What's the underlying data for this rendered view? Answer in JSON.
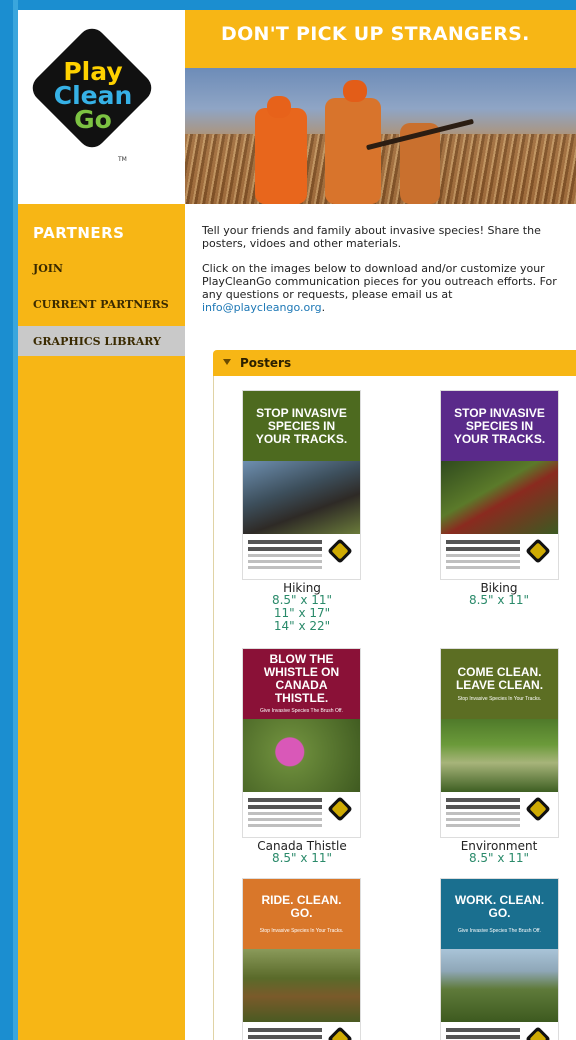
{
  "header": {
    "title": "DON'T PICK UP STRANGERS."
  },
  "logo": {
    "line1": "Play",
    "line2": "Clean",
    "line3": "Go",
    "tm": "TM"
  },
  "sidebar": {
    "title": "PARTNERS",
    "items": [
      {
        "label": "JOIN"
      },
      {
        "label": "CURRENT PARTNERS"
      },
      {
        "label": "GRAPHICS LIBRARY"
      }
    ]
  },
  "intro": {
    "p1": "Tell your friends and family about invasive species! Share the posters, vidoes and other materials.",
    "p2": "Click on the images below to download and/or customize your PlayCleanGo communication pieces for you outreach efforts. For any questions or requests, please email us at",
    "email": "info@playcleango.org",
    "period": "."
  },
  "panel": {
    "title": "Posters"
  },
  "posters": [
    {
      "headline": "STOP INVASIVE SPECIES IN YOUR TRACKS.",
      "name": "Hiking",
      "sizes": [
        "8.5\" x 11\"",
        "11\" x 17\"",
        "14\" x 22\""
      ],
      "color": "#4d6a1f"
    },
    {
      "headline": "STOP INVASIVE SPECIES IN YOUR TRACKS.",
      "name": "Biking",
      "sizes": [
        "8.5\" x 11\""
      ],
      "color": "#5a2a8a"
    },
    {
      "headline": "BLOW THE WHISTLE ON CANADA THISTLE.",
      "sub": "Give Invasive Species The Brush Off.",
      "name": "Canada Thistle",
      "sizes": [
        "8.5\" x 11\""
      ],
      "color": "#8a1137"
    },
    {
      "headline": "COME CLEAN. LEAVE CLEAN.",
      "sub": "Stop Invasive Species In Your Tracks.",
      "name": "Environment",
      "sizes": [
        "8.5\" x 11\""
      ],
      "color": "#5c6e23"
    },
    {
      "headline": "RIDE. CLEAN. GO.",
      "sub": "Stop Invasive Species In Your Tracks.",
      "color": "#d9772a"
    },
    {
      "headline": "WORK. CLEAN. GO.",
      "sub": "Give Invasive Species The Brush Off.",
      "color": "#1a6f8f"
    }
  ],
  "colors": {
    "brand_yellow": "#f7b615",
    "link": "#1c77b5",
    "size_text": "#2a8a6a",
    "frame_blue": "#1b8ed0"
  }
}
